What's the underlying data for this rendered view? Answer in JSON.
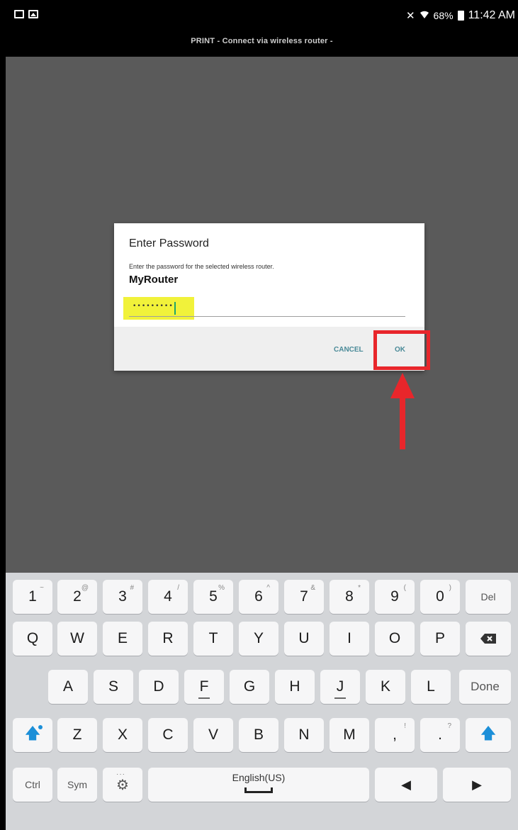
{
  "status_bar": {
    "battery_percent": "68%",
    "time": "11:42 AM",
    "left_icons": [
      "keyboard-icon",
      "image-icon"
    ],
    "right_icons": [
      "vibrate-icon",
      "wifi-icon",
      "battery-icon"
    ]
  },
  "app_bar": {
    "title": "PRINT  - Connect via wireless router -"
  },
  "dialog": {
    "title": "Enter Password",
    "message": "Enter the password for the selected wireless router.",
    "ssid": "MyRouter",
    "password_value": "•••••••••",
    "cancel_label": "CANCEL",
    "ok_label": "OK"
  },
  "annotation": {
    "color": "#e8262b",
    "highlight_color": "#f1f23a",
    "target": "ok-button"
  },
  "keyboard": {
    "row1": [
      {
        "main": "1",
        "sub": "~"
      },
      {
        "main": "2",
        "sub": "@"
      },
      {
        "main": "3",
        "sub": "#"
      },
      {
        "main": "4",
        "sub": "/"
      },
      {
        "main": "5",
        "sub": "%"
      },
      {
        "main": "6",
        "sub": "^"
      },
      {
        "main": "7",
        "sub": "&"
      },
      {
        "main": "8",
        "sub": "*"
      },
      {
        "main": "9",
        "sub": "("
      },
      {
        "main": "0",
        "sub": ")"
      }
    ],
    "del_label": "Del",
    "row2": [
      "Q",
      "W",
      "E",
      "R",
      "T",
      "Y",
      "U",
      "I",
      "O",
      "P"
    ],
    "row3": [
      "A",
      "S",
      "D",
      "F",
      "G",
      "H",
      "J",
      "K",
      "L"
    ],
    "done_label": "Done",
    "row4": [
      "Z",
      "X",
      "C",
      "V",
      "B",
      "N",
      "M"
    ],
    "comma_main": ",",
    "comma_sub": "!",
    "period_main": ".",
    "period_sub": "?",
    "ctrl_label": "Ctrl",
    "sym_label": "Sym",
    "space_label": "English(US)",
    "accent_color": "#1c8fd8"
  }
}
